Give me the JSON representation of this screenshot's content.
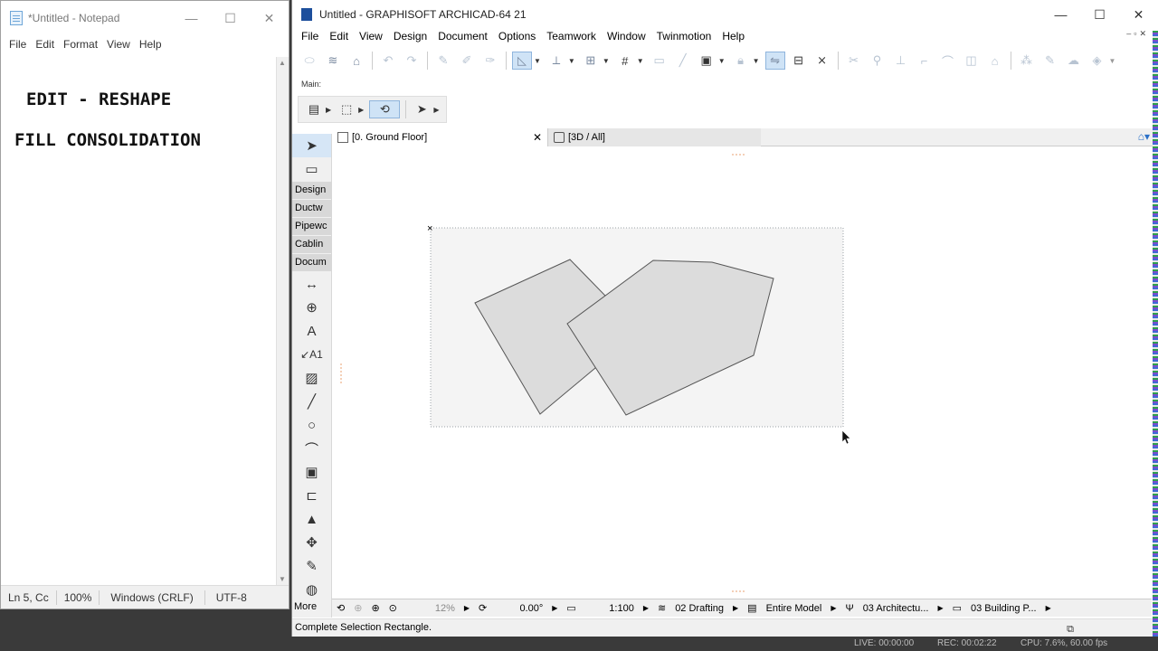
{
  "notepad": {
    "title": "*Untitled - Notepad",
    "window_controls": [
      "—",
      "☐",
      "✕"
    ],
    "menu": [
      "File",
      "Edit",
      "Format",
      "View",
      "Help"
    ],
    "lines": [
      "EDIT - RESHAPE",
      "FILL CONSOLIDATION"
    ],
    "status": {
      "position": "Ln 5, Cc",
      "zoom": "100%",
      "eol": "Windows (CRLF)",
      "encoding": "UTF-8"
    }
  },
  "archicad": {
    "title": "Untitled - GRAPHISOFT ARCHICAD-64 21",
    "window_controls": [
      "—",
      "☐",
      "✕"
    ],
    "menu": [
      "File",
      "Edit",
      "View",
      "Design",
      "Document",
      "Options",
      "Teamwork",
      "Window",
      "Twinmotion",
      "Help"
    ],
    "toolbar_label": "Main:",
    "toolbox_categories": [
      "Design",
      "Ductw",
      "Pipewc",
      "Cablin",
      "Docum"
    ],
    "more_label": "More",
    "tabs": [
      {
        "label": "[0. Ground Floor]",
        "close": "✕"
      },
      {
        "label": "[3D / All]"
      }
    ],
    "quick_options": {
      "zoom": "12%",
      "angle": "0.00°",
      "scale": "1:100",
      "layer_combo": "02 Drafting",
      "model_view": "Entire Model",
      "pen_set": "03 Architectu...",
      "renovation": "03 Building P..."
    },
    "status_text": "Complete Selection Rectangle.",
    "recorder": {
      "live": "LIVE: 00:00:00",
      "rec": "REC: 00:02:22",
      "cpu": "CPU: 7.6%, 60.00 fps"
    }
  }
}
